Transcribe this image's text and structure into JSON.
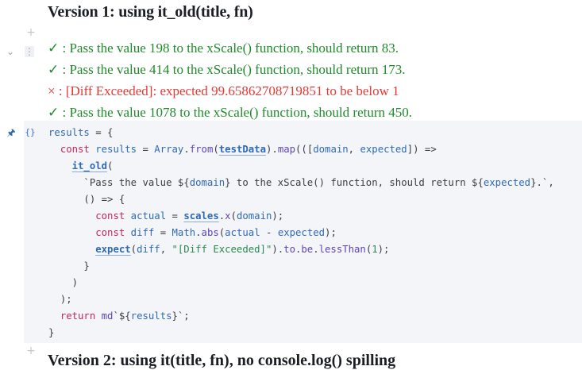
{
  "heading": "Version 1: using it_old(title, fn)",
  "output": [
    {
      "mark": "✓",
      "text": " : Pass the value 198 to the xScale() function, should return 83.",
      "status": "pass"
    },
    {
      "mark": "✓",
      "text": " : Pass the value 414 to the xScale() function, should return 173.",
      "status": "pass"
    },
    {
      "mark": "×",
      "text": " : [Diff Exceeded]: expected 99.65862708719851 to be below 1",
      "status": "fail"
    },
    {
      "mark": "✓",
      "text": " : Pass the value 1078 to the xScale() function, should return 450.",
      "status": "pass"
    }
  ],
  "code": {
    "l1": {
      "a": "results",
      "b": " = {"
    },
    "l2": {
      "a": "const",
      "b": "results",
      "c": " = ",
      "d": "Array",
      "e": ".",
      "f": "from",
      "g": "(",
      "h": "testData",
      "i": ").",
      "j": "map",
      "k": "(([",
      "l": "domain",
      "m": ", ",
      "n": "expected",
      "o": "]) =>"
    },
    "l3": {
      "a": "it_old",
      "b": "("
    },
    "l4": {
      "a": "`Pass the value ${",
      "b": "domain",
      "c": "} to the xScale() function, should return ${",
      "d": "expected",
      "e": "}.`",
      "f": ","
    },
    "l5": {
      "a": "() => {"
    },
    "l6": {
      "a": "const",
      "b": "actual",
      "c": " = ",
      "d": "scales",
      "e": ".",
      "f": "x",
      "g": "(",
      "h": "domain",
      "i": ");"
    },
    "l7": {
      "a": "const",
      "b": "diff",
      "c": " = ",
      "d": "Math",
      "e": ".",
      "f": "abs",
      "g": "(",
      "h": "actual",
      "i": " - ",
      "j": "expected",
      "k": ");"
    },
    "l8": {
      "a": "expect",
      "b": "(",
      "c": "diff",
      "d": ", ",
      "e": "\"[Diff Exceeded]\"",
      "f": ").",
      "g": "to",
      "h": ".",
      "i": "be",
      "j": ".",
      "k": "lessThan",
      "l": "(",
      "m": "1",
      "n": ");"
    },
    "l9": {
      "a": "}"
    },
    "l10": {
      "a": ")"
    },
    "l11": {
      "a": ");"
    },
    "l12": {
      "a": "return",
      "b": " ",
      "c": "md",
      "d": "`${",
      "e": "results",
      "f": "}`;"
    },
    "l13": {
      "a": "}"
    }
  },
  "next_heading": "Version 2: using it(title, fn), no console.log() spilling"
}
